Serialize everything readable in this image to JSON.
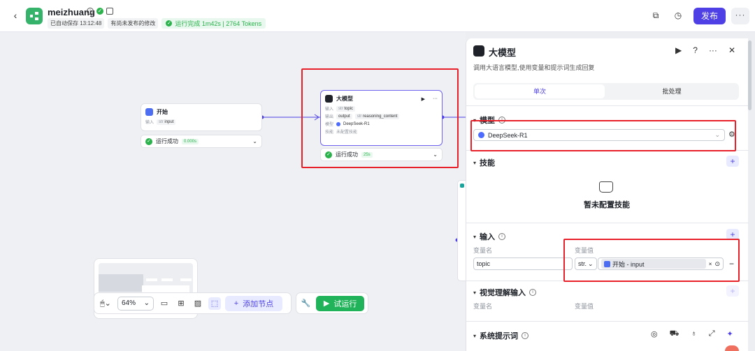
{
  "header": {
    "app_name": "meizhuang",
    "autosave": "已自动保存 13:12:48",
    "unpublished": "有尚未发布的修改",
    "run_status": "运行完成 1m42s | 2764 Tokens",
    "publish_label": "发布"
  },
  "canvas": {
    "start_node": {
      "title": "开始",
      "input_label": "输入",
      "input_type": "str",
      "input_name": "input"
    },
    "start_status": {
      "label": "运行成功",
      "time": "0.000s"
    },
    "llm_node": {
      "title": "大模型",
      "input_label": "输入",
      "input_type": "str",
      "input_name": "topic",
      "output_label": "输出",
      "output_name": "output",
      "output_type2": "str",
      "output_name2": "reasoning_content",
      "model_label": "模型",
      "model_name": "DeepSeek-R1",
      "skill_label": "技能",
      "skill_value": "未配置技能"
    },
    "llm_status": {
      "label": "运行成功",
      "time": "25s"
    }
  },
  "toolbar": {
    "zoom": "64%",
    "add_node": "添加节点",
    "try_run": "试运行"
  },
  "panel": {
    "title": "大模型",
    "description": "调用大语言模型,使用变量和提示词生成回复",
    "tab_single": "单次",
    "tab_batch": "批处理",
    "model_section": "模型",
    "model_value": "DeepSeek-R1",
    "skills_section": "技能",
    "skills_empty": "暂未配置技能",
    "input_section": "输入",
    "var_name_col": "变量名",
    "var_value_col": "变量值",
    "var_name": "topic",
    "var_type": "str.",
    "var_ref": "开始 - input",
    "vision_section": "视觉理解输入",
    "vision_name_col": "变量名",
    "vision_value_col": "变量值",
    "system_prompt_section": "系统提示词"
  }
}
